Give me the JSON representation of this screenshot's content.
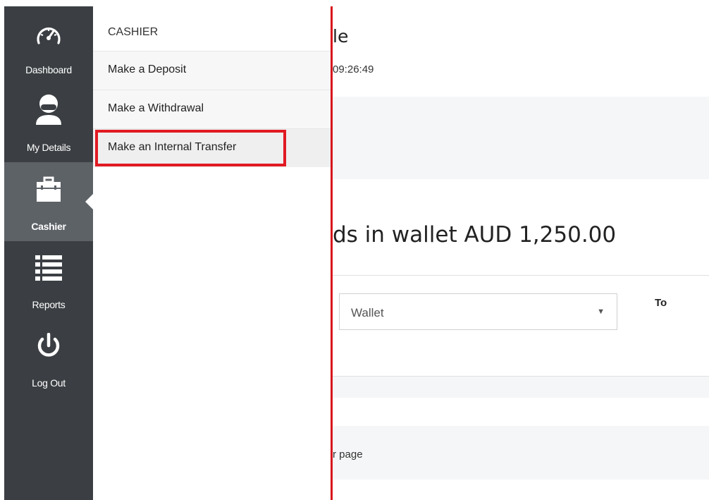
{
  "sidebar": {
    "items": [
      {
        "label": "Dashboard",
        "icon": "speedometer-icon"
      },
      {
        "label": "My Details",
        "icon": "user-icon"
      },
      {
        "label": "Cashier",
        "icon": "briefcase-icon",
        "active": true
      },
      {
        "label": "Reports",
        "icon": "list-icon"
      },
      {
        "label": "Log Out",
        "icon": "power-icon"
      }
    ]
  },
  "flyout": {
    "title": "CASHIER",
    "items": [
      {
        "label": "Make a Deposit"
      },
      {
        "label": "Make a Withdrawal"
      },
      {
        "label": "Make an Internal Transfer",
        "highlighted": true
      }
    ]
  },
  "content": {
    "title_fragment": "le",
    "time_fragment": "09:26:49",
    "funds_fragment": "ds in wallet AUD 1,250.00",
    "from_select": {
      "value": "Wallet"
    },
    "to_label": "To",
    "page_fragment": "r page"
  },
  "colors": {
    "sidebar_bg": "#3b3f43",
    "sidebar_active_bg": "#5d6267",
    "highlight_red": "#e11a22",
    "divider_red": "#d8141c"
  }
}
